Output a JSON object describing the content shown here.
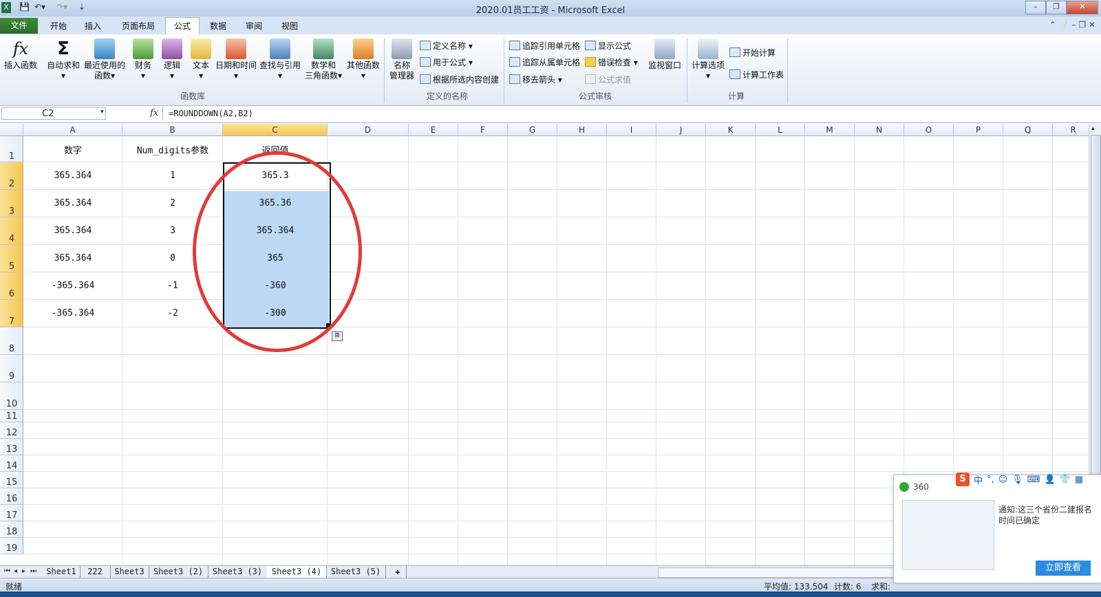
{
  "window": {
    "title": "2020.01员工工资 - Microsoft Excel"
  },
  "ribbon_tabs": [
    {
      "label": "文件"
    },
    {
      "label": "开始"
    },
    {
      "label": "插入"
    },
    {
      "label": "页面布局"
    },
    {
      "label": "公式"
    },
    {
      "label": "数据"
    },
    {
      "label": "审阅"
    },
    {
      "label": "视图"
    }
  ],
  "ribbon": {
    "insert_function": "插入函数",
    "autosum": "自动求和",
    "recent_1": "最近使用的",
    "recent_2": "函数",
    "financial": "财务",
    "logical": "逻辑",
    "text": "文本",
    "datetime": "日期和时间",
    "lookup": "查找与引用",
    "math_1": "数学和",
    "math_2": "三角函数",
    "more": "其他函数",
    "group_library": "函数库",
    "name_mgr_1": "名称",
    "name_mgr_2": "管理器",
    "define_name": "定义名称",
    "use_in_formula": "用于公式",
    "create_from_sel": "根据所选内容创建",
    "group_names": "定义的名称",
    "trace_precedents": "追踪引用单元格",
    "trace_dependents": "追踪从属单元格",
    "remove_arrows": "移去箭头",
    "show_formulas": "显示公式",
    "error_check": "错误检查",
    "eval_formula": "公式求值",
    "watch_window": "监视窗口",
    "group_audit": "公式审核",
    "calc_options": "计算选项",
    "calc_now": "开始计算",
    "calc_sheet": "计算工作表",
    "group_calc": "计算"
  },
  "formula_bar": {
    "name_box": "C2",
    "fx": "fx",
    "formula": "=ROUNDDOWN(A2,B2)"
  },
  "columns": [
    "A",
    "B",
    "C",
    "D",
    "E",
    "F",
    "G",
    "H",
    "I",
    "J",
    "K",
    "L",
    "M",
    "N",
    "O",
    "P",
    "Q",
    "R"
  ],
  "rows": [
    "1",
    "2",
    "3",
    "4",
    "5",
    "6",
    "7",
    "8",
    "9",
    "10",
    "11",
    "12",
    "13",
    "14",
    "15",
    "16",
    "17",
    "18",
    "19"
  ],
  "headers": {
    "a1": "数字",
    "b1": "Num_digits参数",
    "c1": "返回值"
  },
  "data_rows": [
    {
      "a": "365.364",
      "b": "1",
      "c": "365.3"
    },
    {
      "a": "365.364",
      "b": "2",
      "c": "365.36"
    },
    {
      "a": "365.364",
      "b": "3",
      "c": "365.364"
    },
    {
      "a": "365.364",
      "b": "0",
      "c": "365"
    },
    {
      "a": "-365.364",
      "b": "-1",
      "c": "-360"
    },
    {
      "a": "-365.364",
      "b": "-2",
      "c": "-300"
    }
  ],
  "sheets": [
    "Sheet1",
    "222",
    "Sheet3",
    "Sheet3 (2)",
    "Sheet3 (3)",
    "Sheet3 (4)",
    "Sheet3 (5)"
  ],
  "active_sheet": "Sheet3 (4)",
  "status": {
    "ready": "就绪",
    "average": "平均值: 133.504",
    "count": "计数: 6",
    "sum": "求和:"
  },
  "popup": {
    "title": "360",
    "text": "通知:这三个省份二建报名时间已确定",
    "button": "立即查看",
    "ime_zh": "中"
  },
  "colors": {
    "selection_fill": "#bcd8f5",
    "annotation_circle": "#e23a3a",
    "file_tab": "#2a6f2a",
    "header_selected": "#f6c54c"
  }
}
